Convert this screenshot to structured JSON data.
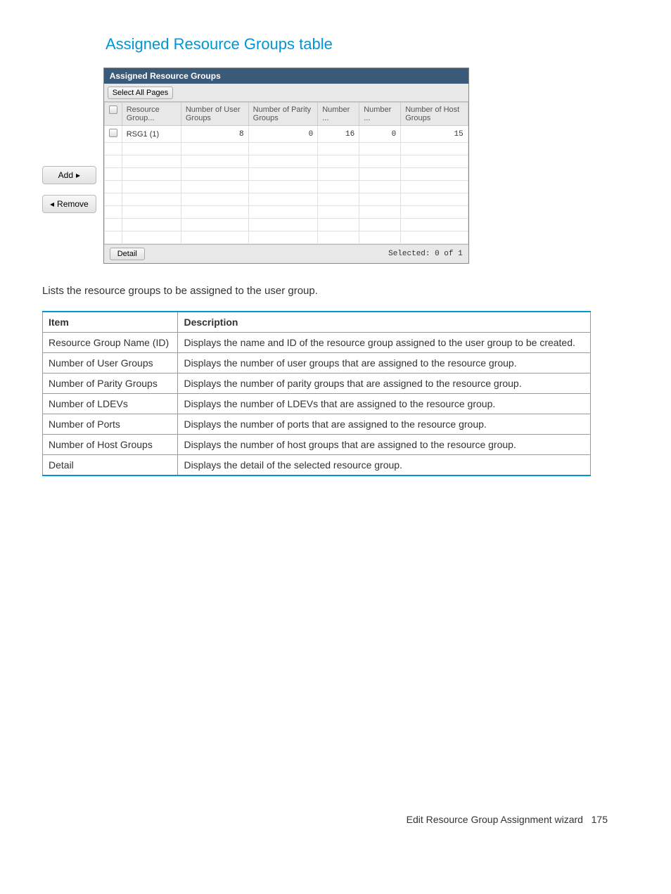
{
  "title": "Assigned Resource Groups table",
  "widget": {
    "header": "Assigned Resource Groups",
    "select_all_label": "Select All Pages",
    "columns": {
      "c1": "Resource Group...",
      "c2": "Number of User Groups",
      "c3": "Number of Parity Groups",
      "c4": "Number ...",
      "c5": "Number ...",
      "c6": "Number of Host Groups"
    },
    "rows": [
      {
        "name": "RSG1 (1)",
        "user_groups": "8",
        "parity_groups": "0",
        "col4": "16",
        "col5": "0",
        "host_groups": "15"
      }
    ],
    "detail_label": "Detail",
    "selected_text": "Selected:  0   of  1"
  },
  "side": {
    "add": "Add",
    "remove": "Remove"
  },
  "description": "Lists the resource groups to be assigned to the user group.",
  "info_table": {
    "headers": {
      "item": "Item",
      "desc": "Description"
    },
    "rows": [
      {
        "item": "Resource Group Name (ID)",
        "desc": "Displays the name and ID of the resource group assigned to the user group to be created."
      },
      {
        "item": "Number of User Groups",
        "desc": "Displays the number of user groups that are assigned to the resource group."
      },
      {
        "item": "Number of Parity Groups",
        "desc": "Displays the number of parity groups that are assigned to the resource group."
      },
      {
        "item": "Number of LDEVs",
        "desc": "Displays the number of LDEVs that are assigned to the resource group."
      },
      {
        "item": "Number of Ports",
        "desc": "Displays the number of ports that are assigned to the resource group."
      },
      {
        "item": "Number of Host Groups",
        "desc": "Displays the number of host groups that are assigned to the resource group."
      },
      {
        "item": "Detail",
        "desc": "Displays the detail of the selected resource group."
      }
    ]
  },
  "footer": {
    "text": "Edit Resource Group Assignment wizard",
    "page": "175"
  }
}
